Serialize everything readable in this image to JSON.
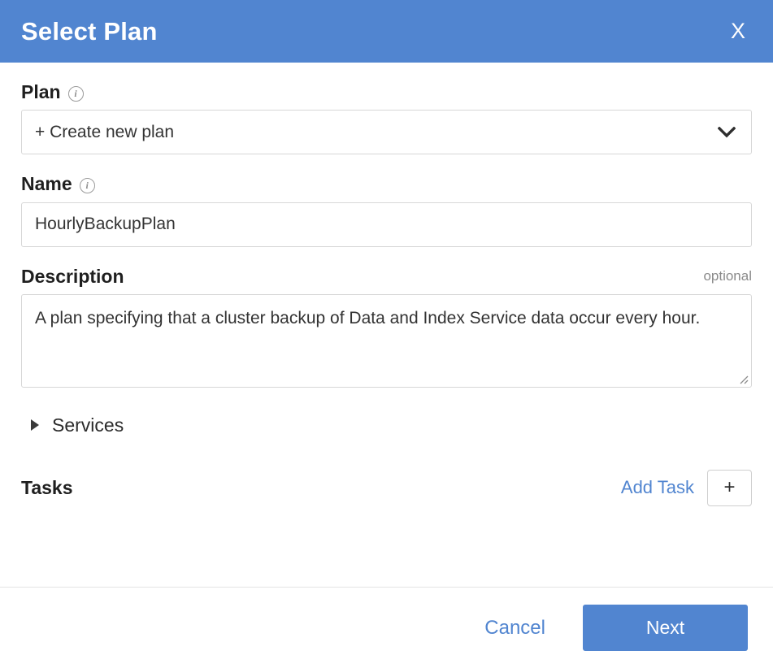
{
  "header": {
    "title": "Select Plan",
    "close_label": "X",
    "accent_color": "#5185d0"
  },
  "form": {
    "plan": {
      "label": "Plan",
      "info_icon": "info-icon",
      "selected_option": "+ Create new plan",
      "chevron_icon": "chevron-down-icon"
    },
    "name": {
      "label": "Name",
      "info_icon": "info-icon",
      "value": "HourlyBackupPlan",
      "placeholder": ""
    },
    "description": {
      "label": "Description",
      "optional_tag": "optional",
      "value": "A plan specifying that a cluster backup of Data and Index Service data occur every hour.",
      "placeholder": "",
      "resize_icon": "resize-grip-icon"
    },
    "services": {
      "label": "Services",
      "disclosure_icon": "triangle-right-icon",
      "expanded": false
    },
    "tasks": {
      "title": "Tasks",
      "add_task_label": "Add Task",
      "add_button_label": "+",
      "add_button_icon": "plus-icon"
    }
  },
  "footer": {
    "cancel_label": "Cancel",
    "next_label": "Next"
  }
}
